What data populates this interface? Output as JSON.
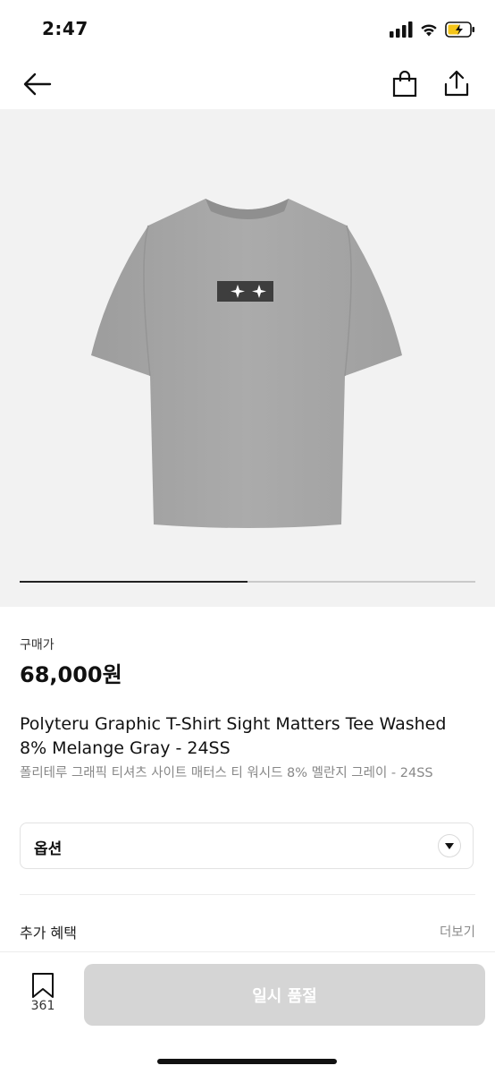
{
  "status_bar": {
    "time": "2:47"
  },
  "nav": {
    "back_icon": "arrow-left-icon",
    "bag_icon": "shopping-bag-icon",
    "share_icon": "share-icon"
  },
  "gallery": {
    "slide_position": 0.5,
    "image": "gray t-shirt product photo"
  },
  "product": {
    "price_label": "구매가",
    "price": "68,000원",
    "title_en": "Polyteru Graphic T-Shirt Sight Matters Tee Washed 8% Melange Gray - 24SS",
    "title_ko": "폴리테루 그래픽 티셔츠 사이트 매터스 티 워시드 8% 멜란지 그레이 - 24SS"
  },
  "option": {
    "label": "옵션"
  },
  "benefits": {
    "title": "추가 혜택",
    "more": "더보기"
  },
  "bottom_bar": {
    "bookmark_count": "361",
    "button_label": "일시 품절"
  },
  "colors": {
    "button_disabled": "#d5d5d5",
    "hero_bg": "#f2f2f2",
    "shirt": "#a9a9a9"
  }
}
